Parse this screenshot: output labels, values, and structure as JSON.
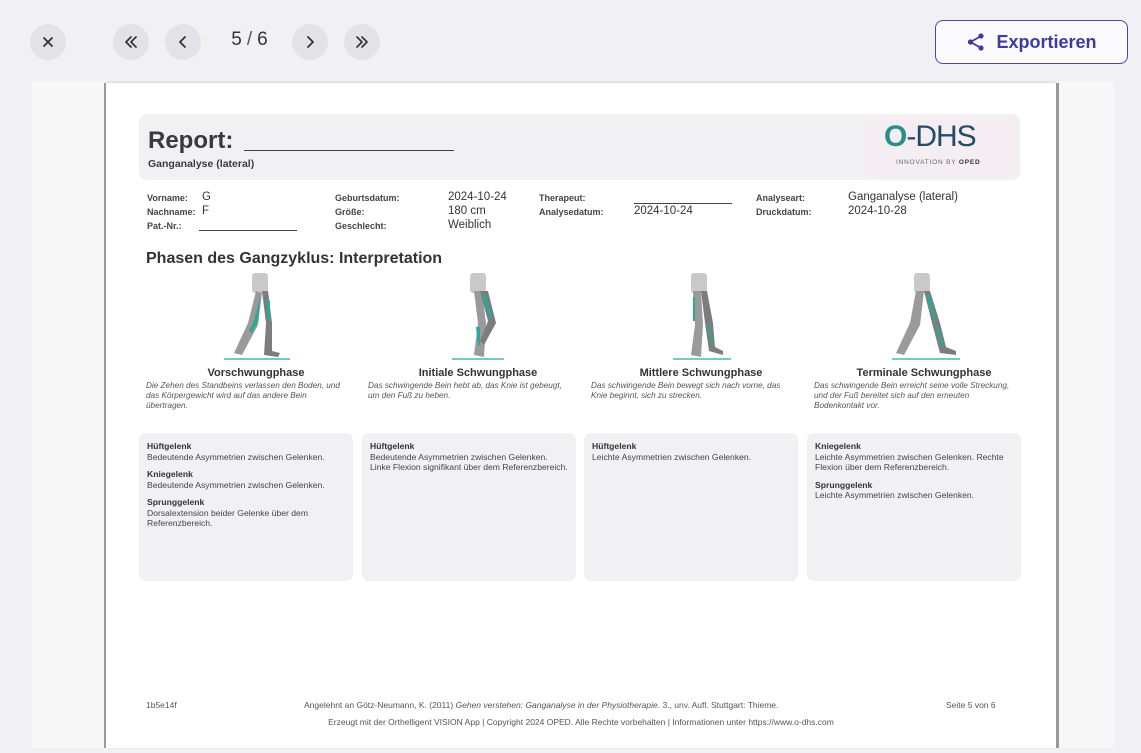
{
  "toolbar": {
    "page_current": "5",
    "page_total": "6",
    "export_label": "Exportieren",
    "icons": [
      "close-icon",
      "double-chevron-left-icon",
      "chevron-left-icon",
      "chevron-right-icon",
      "double-chevron-right-icon",
      "share-icon"
    ],
    "accent_color": "#3e3aa0"
  },
  "report": {
    "title": "Report:",
    "subtitle": "Ganganalyse (lateral)",
    "logo": {
      "word": "O-DHS",
      "tag_prefix": "INNOVATION BY ",
      "tag_brand": "OPED"
    },
    "patient": {
      "vorname_label": "Vorname:",
      "vorname": "G",
      "nachname_label": "Nachname:",
      "nachname": "F",
      "patnr_label": "Pat.-Nr.:",
      "geburt_label": "Geburtsdatum:",
      "geburt": "2024-10-24",
      "groesse_label": "Größe:",
      "groesse": "180 cm",
      "geschlecht_label": "Geschlecht:",
      "geschlecht": "Weiblich",
      "therapeut_label": "Therapeut:",
      "analysedatum_label": "Analysedatum:",
      "analysedatum": "2024-10-24",
      "analyseart_label": "Analyseart:",
      "analyseart": "Ganganalyse (lateral)",
      "druckdatum_label": "Druckdatum:",
      "druckdatum": "2024-10-28"
    },
    "section_title": "Phasen des Gangzyklus: Interpretation",
    "phases": [
      {
        "name": "Vorschwungphase",
        "description": "Die Zehen des Standbeins verlassen den Boden, und das Körpergewicht wird auf das andere Bein übertragen.",
        "findings": [
          {
            "joint": "Hüftgelenk",
            "text": "Bedeutende Asymmetrien zwischen Gelenken."
          },
          {
            "joint": "Kniegelenk",
            "text": "Bedeutende Asymmetrien zwischen Gelenken."
          },
          {
            "joint": "Sprunggelenk",
            "text": "Dorsalextension beider Gelenke über dem Referenzbereich."
          }
        ]
      },
      {
        "name": "Initiale Schwungphase",
        "description": "Das schwingende Bein hebt ab, das Knie ist gebeugt, um den Fuß zu heben.",
        "findings": [
          {
            "joint": "Hüftgelenk",
            "text": "Bedeutende Asymmetrien zwischen Gelenken. Linke Flexion signifikant über dem Referenzbereich."
          }
        ]
      },
      {
        "name": "Mittlere Schwungphase",
        "description": "Das schwingende Bein bewegt sich nach vorne, das Knie beginnt, sich zu strecken.",
        "findings": [
          {
            "joint": "Hüftgelenk",
            "text": "Leichte Asymmetrien zwischen Gelenken."
          }
        ]
      },
      {
        "name": "Terminale Schwungphase",
        "description": "Das schwingende Bein erreicht seine volle Streckung, und der Fuß bereitet sich auf den erneuten Bodenkontakt vor.",
        "findings": [
          {
            "joint": "Kniegelenk",
            "text": "Leichte Asymmetrien zwischen Gelenken. Rechte Flexion über dem Referenzbereich."
          },
          {
            "joint": "Sprunggelenk",
            "text": "Leichte Asymmetrien zwischen Gelenken."
          }
        ]
      }
    ],
    "footer": {
      "id": "1b5e14f",
      "ref_prefix": "Angelehnt an Götz-Neumann, K. (2011) ",
      "ref_title": "Gehen verstehen: Ganganalyse in der Physiotherapie",
      "ref_suffix": ". 3., unv. Aufl. Stuttgart: Thieme.",
      "page": "Seite 5 von 6",
      "copyright": "Erzeugt mit der Orthelligent VISION App | Copyright 2024 OPED. Alle Rechte vorbehalten | Informationen unter https://www.o-dhs.com"
    }
  }
}
